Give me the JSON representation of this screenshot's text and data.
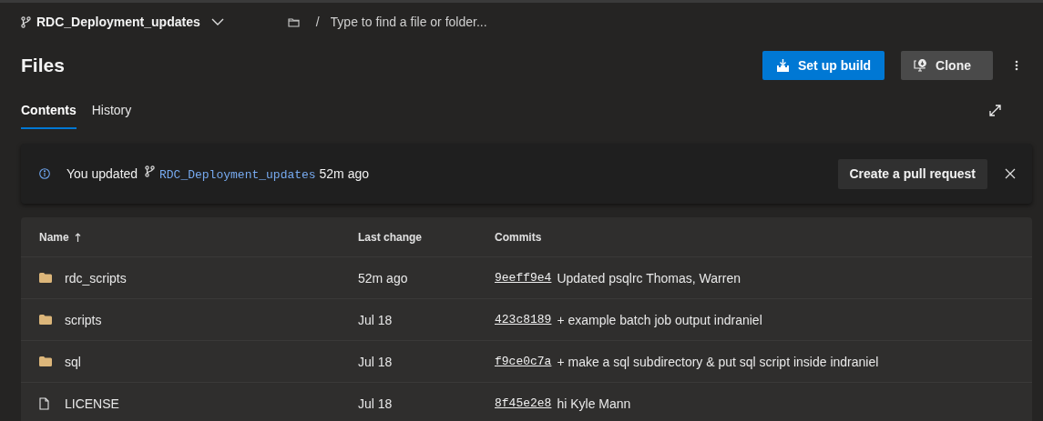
{
  "branch": {
    "name": "RDC_Deployment_updates"
  },
  "path_search": {
    "separator": "/",
    "placeholder": "Type to find a file or folder..."
  },
  "title": "Files",
  "actions": [
    {
      "kind": "primary",
      "label": "Set up build"
    },
    {
      "kind": "secondary",
      "label": "Clone"
    }
  ],
  "tabs": [
    {
      "label": "Contents",
      "selected": true
    },
    {
      "label": "History",
      "selected": false
    }
  ],
  "banner": {
    "prefix": "You updated",
    "branch": "RDC_Deployment_updates",
    "suffix": "52m ago",
    "button": "Create a pull request"
  },
  "table": {
    "columns": [
      {
        "label": "Name",
        "sorted": true
      },
      {
        "label": "Last change",
        "sorted": false
      },
      {
        "label": "Commits",
        "sorted": false
      }
    ],
    "rows": [
      {
        "kind": "folder",
        "name": "rdc_scripts",
        "last_change": "52m ago",
        "commit": "9eeff9e4",
        "message": "Updated psqlrc Thomas, Warren"
      },
      {
        "kind": "folder",
        "name": "scripts",
        "last_change": "Jul 18",
        "commit": "423c8189",
        "message": "+ example batch job output indraniel"
      },
      {
        "kind": "folder",
        "name": "sql",
        "last_change": "Jul 18",
        "commit": "f9ce0c7a",
        "message": "+ make a sql subdirectory & put sql script inside indraniel"
      },
      {
        "kind": "file",
        "name": "LICENSE",
        "last_change": "Jul 18",
        "commit": "8f45e2e8",
        "message": "hi Kyle Mann"
      }
    ]
  }
}
